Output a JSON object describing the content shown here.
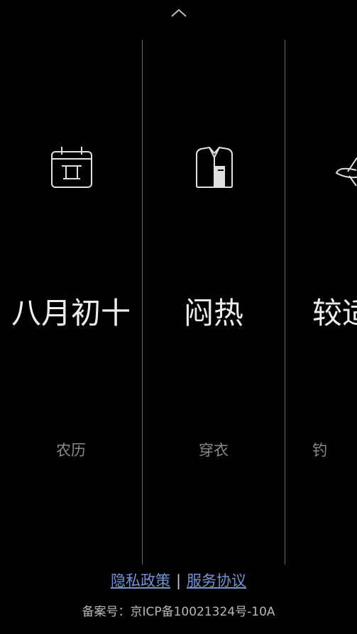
{
  "top": {
    "collapse_icon": "chevron-up-icon"
  },
  "cards": [
    {
      "icon": "calendar-icon",
      "value": "八月初十",
      "label": "农历"
    },
    {
      "icon": "shirt-icon",
      "value": "闷热",
      "label": "穿衣"
    },
    {
      "icon": "fishing-icon",
      "value": "较适",
      "label": "钓"
    }
  ],
  "footer": {
    "privacy_link": "隐私政策",
    "separator": "|",
    "service_link": "服务协议",
    "record_number": "备案号：京ICP备10021324号-10A"
  },
  "colors": {
    "background": "#000000",
    "link": "#6f93d6",
    "divider": "#6a6a6a"
  }
}
